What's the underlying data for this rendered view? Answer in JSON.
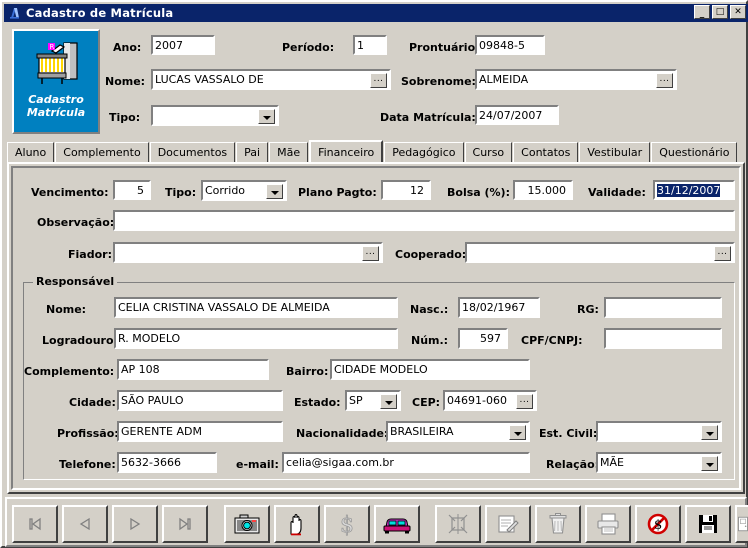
{
  "window": {
    "title": "Cadastro de Matrícula",
    "icon": "app-logo-icon",
    "minimize_label": "_",
    "maximize_label": "□",
    "close_label": "✕"
  },
  "logo": {
    "caption_line1": "Cadastro",
    "caption_line2": "Matrícula",
    "icon": "enrollment-register-icon",
    "background": "#0080c0"
  },
  "header": {
    "ano": {
      "label": "Ano:",
      "value": "2007"
    },
    "periodo": {
      "label": "Período:",
      "value": "1"
    },
    "prontuario": {
      "label": "Prontuário:",
      "value": "09848-5"
    },
    "nome": {
      "label": "Nome:",
      "value": "LUCAS VASSALO DE",
      "browse": "..."
    },
    "sobrenome": {
      "label": "Sobrenome:",
      "value": "ALMEIDA",
      "browse": "..."
    },
    "tipo": {
      "label": "Tipo:",
      "value": ""
    },
    "data_matricula": {
      "label": "Data Matrícula:",
      "value": "24/07/2007"
    }
  },
  "tabs": [
    {
      "label": "Aluno",
      "active": false
    },
    {
      "label": "Complemento",
      "active": false
    },
    {
      "label": "Documentos",
      "active": false
    },
    {
      "label": "Pai",
      "active": false
    },
    {
      "label": "Mãe",
      "active": false
    },
    {
      "label": "Financeiro",
      "active": true
    },
    {
      "label": "Pedagógico",
      "active": false
    },
    {
      "label": "Curso",
      "active": false
    },
    {
      "label": "Contatos",
      "active": false
    },
    {
      "label": "Vestibular",
      "active": false
    },
    {
      "label": "Questionário",
      "active": false
    }
  ],
  "financeiro": {
    "vencimento": {
      "label": "Vencimento:",
      "value": "5"
    },
    "tipo": {
      "label": "Tipo:",
      "value": "Corrido"
    },
    "plano_pagto": {
      "label": "Plano Pagto:",
      "value": "12"
    },
    "bolsa": {
      "label": "Bolsa (%):",
      "value": "15.000"
    },
    "validade": {
      "label": "Validade:",
      "value": "31/12/2007",
      "selected": true
    },
    "observacao": {
      "label": "Observação:",
      "value": ""
    },
    "fiador": {
      "label": "Fiador:",
      "value": "",
      "browse": "..."
    },
    "cooperado": {
      "label": "Cooperado:",
      "value": "",
      "browse": "..."
    }
  },
  "responsavel": {
    "group_title": "Responsável",
    "nome": {
      "label": "Nome:",
      "value": "CELIA CRISTINA VASSALO DE ALMEIDA"
    },
    "nasc": {
      "label": "Nasc.:",
      "value": "18/02/1967"
    },
    "rg": {
      "label": "RG:",
      "value": ""
    },
    "logradouro": {
      "label": "Logradouro:",
      "value": "R. MODELO"
    },
    "num": {
      "label": "Núm.:",
      "value": "597"
    },
    "cpf_cnpj": {
      "label": "CPF/CNPJ:",
      "value": ""
    },
    "complemento": {
      "label": "Complemento:",
      "value": "AP 108"
    },
    "bairro": {
      "label": "Bairro:",
      "value": "CIDADE MODELO"
    },
    "cidade": {
      "label": "Cidade:",
      "value": "SÃO PAULO"
    },
    "estado": {
      "label": "Estado:",
      "value": "SP"
    },
    "cep": {
      "label": "CEP:",
      "value": "04691-060",
      "browse": "..."
    },
    "profissao": {
      "label": "Profissão:",
      "value": "GERENTE ADM"
    },
    "nacionalidade": {
      "label": "Nacionalidade:",
      "value": "BRASILEIRA"
    },
    "est_civil": {
      "label": "Est. Civil:",
      "value": ""
    },
    "telefone": {
      "label": "Telefone:",
      "value": "5632-3666"
    },
    "email": {
      "label": "e-mail:",
      "value": "celia@sigaa.com.br"
    },
    "relacao": {
      "label": "Relação:",
      "value": "MÃE"
    }
  },
  "toolbar": {
    "buttons": [
      {
        "name": "first-record-button",
        "icon": "first-record-icon",
        "enabled": false
      },
      {
        "name": "previous-record-button",
        "icon": "previous-record-icon",
        "enabled": false
      },
      {
        "name": "next-record-button",
        "icon": "next-record-icon",
        "enabled": false
      },
      {
        "name": "last-record-button",
        "icon": "last-record-icon",
        "enabled": false
      },
      {
        "name": "photo-button",
        "icon": "camera-icon",
        "enabled": true
      },
      {
        "name": "hand-button",
        "icon": "hand-icon",
        "enabled": true
      },
      {
        "name": "finance-button",
        "icon": "dollar-icon",
        "enabled": true
      },
      {
        "name": "transport-button",
        "icon": "car-icon",
        "enabled": true
      },
      {
        "name": "new-record-button",
        "icon": "new-record-icon",
        "enabled": false
      },
      {
        "name": "edit-record-button",
        "icon": "edit-record-icon",
        "enabled": false
      },
      {
        "name": "delete-record-button",
        "icon": "trash-icon",
        "enabled": false
      },
      {
        "name": "print-button",
        "icon": "printer-icon",
        "enabled": false
      },
      {
        "name": "cancel-button",
        "icon": "cancel-icon",
        "enabled": true
      },
      {
        "name": "save-button",
        "icon": "floppy-disk-icon",
        "enabled": true
      },
      {
        "name": "exit-button",
        "icon": "door-exit-icon",
        "enabled": false
      }
    ]
  },
  "colors": {
    "titlebar": "#0a246a",
    "face": "#d4d0c8",
    "field": "#ffffff",
    "selection": "#0a246a",
    "logo": "#0080c0"
  }
}
